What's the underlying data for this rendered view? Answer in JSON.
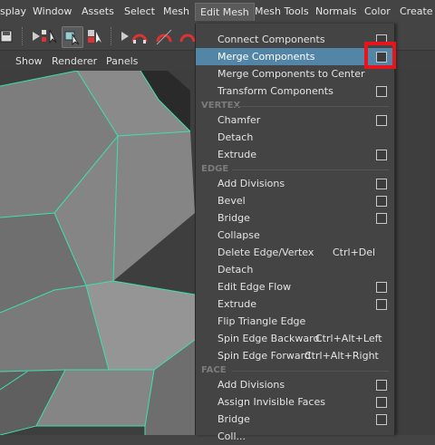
{
  "menubar": {
    "items": [
      "splay",
      "Window",
      "Assets",
      "Select",
      "Mesh",
      "Edit Mesh",
      "Mesh Tools",
      "Normals",
      "Color",
      "Create U"
    ],
    "active_index": 5
  },
  "panel_menu": [
    "Show",
    "Renderer",
    "Panels"
  ],
  "panel_left_fragment": "",
  "dropdown": {
    "items": [
      {
        "label": "Connect Components",
        "option_box": true
      },
      {
        "label": "Merge Components",
        "option_box": true,
        "highlighted": true
      },
      {
        "label": "Merge Components to Center",
        "option_box": false
      },
      {
        "label": "Transform Components",
        "option_box": true
      }
    ],
    "sections": [
      {
        "title": "VERTEX",
        "items": [
          {
            "label": "Chamfer",
            "option_box": true
          },
          {
            "label": "Detach",
            "option_box": false
          },
          {
            "label": "Extrude",
            "option_box": true
          }
        ]
      },
      {
        "title": "EDGE",
        "items": [
          {
            "label": "Add Divisions",
            "option_box": true
          },
          {
            "label": "Bevel",
            "option_box": true
          },
          {
            "label": "Bridge",
            "option_box": true
          },
          {
            "label": "Collapse",
            "option_box": false
          },
          {
            "label": "Delete Edge/Vertex",
            "shortcut": "Ctrl+Del",
            "option_box": false
          },
          {
            "label": "Detach",
            "option_box": false
          },
          {
            "label": "Edit Edge Flow",
            "option_box": true
          },
          {
            "label": "Extrude",
            "option_box": true
          },
          {
            "label": "Flip Triangle Edge",
            "option_box": false
          },
          {
            "label": "Spin Edge Backward",
            "shortcut": "Ctrl+Alt+Left",
            "option_box": false
          },
          {
            "label": "Spin Edge Forward",
            "shortcut": "Ctrl+Alt+Right",
            "option_box": false
          }
        ]
      },
      {
        "title": "FACE",
        "items": [
          {
            "label": "Add Divisions",
            "option_box": true
          },
          {
            "label": "Assign Invisible Faces",
            "option_box": true
          },
          {
            "label": "Bridge",
            "option_box": true
          },
          {
            "label": "Coll...",
            "option_box": false
          }
        ]
      }
    ]
  },
  "colors": {
    "highlight": "#5285a6",
    "wireframe": "#3de0b0",
    "callout": "#e8141c"
  }
}
